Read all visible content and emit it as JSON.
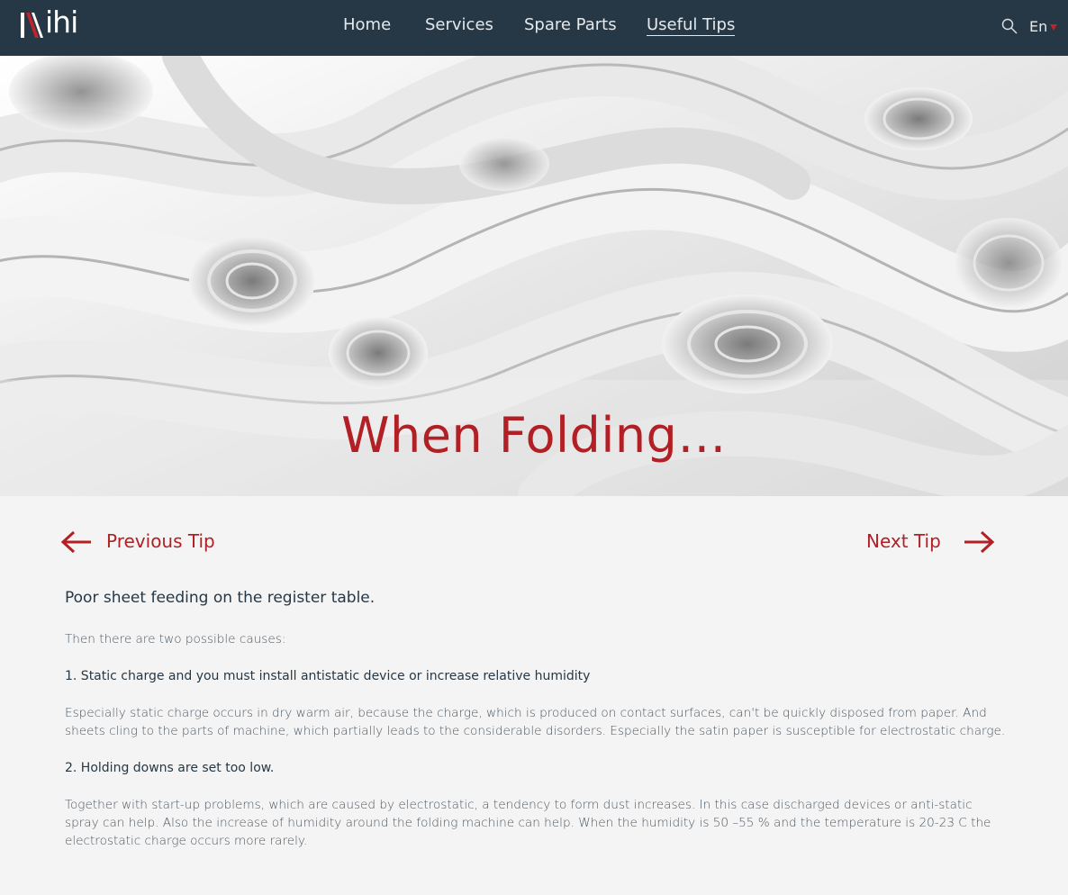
{
  "header": {
    "logo_text": "ihi",
    "nav": [
      {
        "label": "Home"
      },
      {
        "label": "Services"
      },
      {
        "label": "Spare Parts"
      },
      {
        "label": "Useful Tips",
        "active": true
      }
    ],
    "search_icon": "search-icon",
    "language": "En"
  },
  "hero": {
    "title": "When Folding…"
  },
  "tip_nav": {
    "previous_label": "Previous Tip",
    "next_label": "Next Tip"
  },
  "article": {
    "heading": "Poor sheet feeding on the register table.",
    "intro": "Then there are two possible causes:",
    "point1_title": "1. Static charge and you must install antistatic device or increase relative humidity",
    "point1_body": "Especially static charge occurs in dry warm air, because the charge, which is produced on contact surfaces, can't be quickly disposed from paper. And sheets cling to the parts of machine, which partially leads to the considerable disorders. Especially the satin paper is susceptible for electrostatic charge.",
    "point2_title": "2. Holding downs are set too low.",
    "point2_body": "Together with start-up problems, which are caused by electrostatic, a tendency to form dust increases. In this case discharged devices or anti-static spray can help. Also the increase of humidity around the folding machine can help. When the humidity is 50 –55 % and the temperature is 20-23 C the electrostatic charge occurs more rarely."
  },
  "colors": {
    "header_bg": "#263845",
    "accent_red": "#b21f24",
    "page_bg": "#f4f4f4",
    "text_dark": "#263845"
  }
}
